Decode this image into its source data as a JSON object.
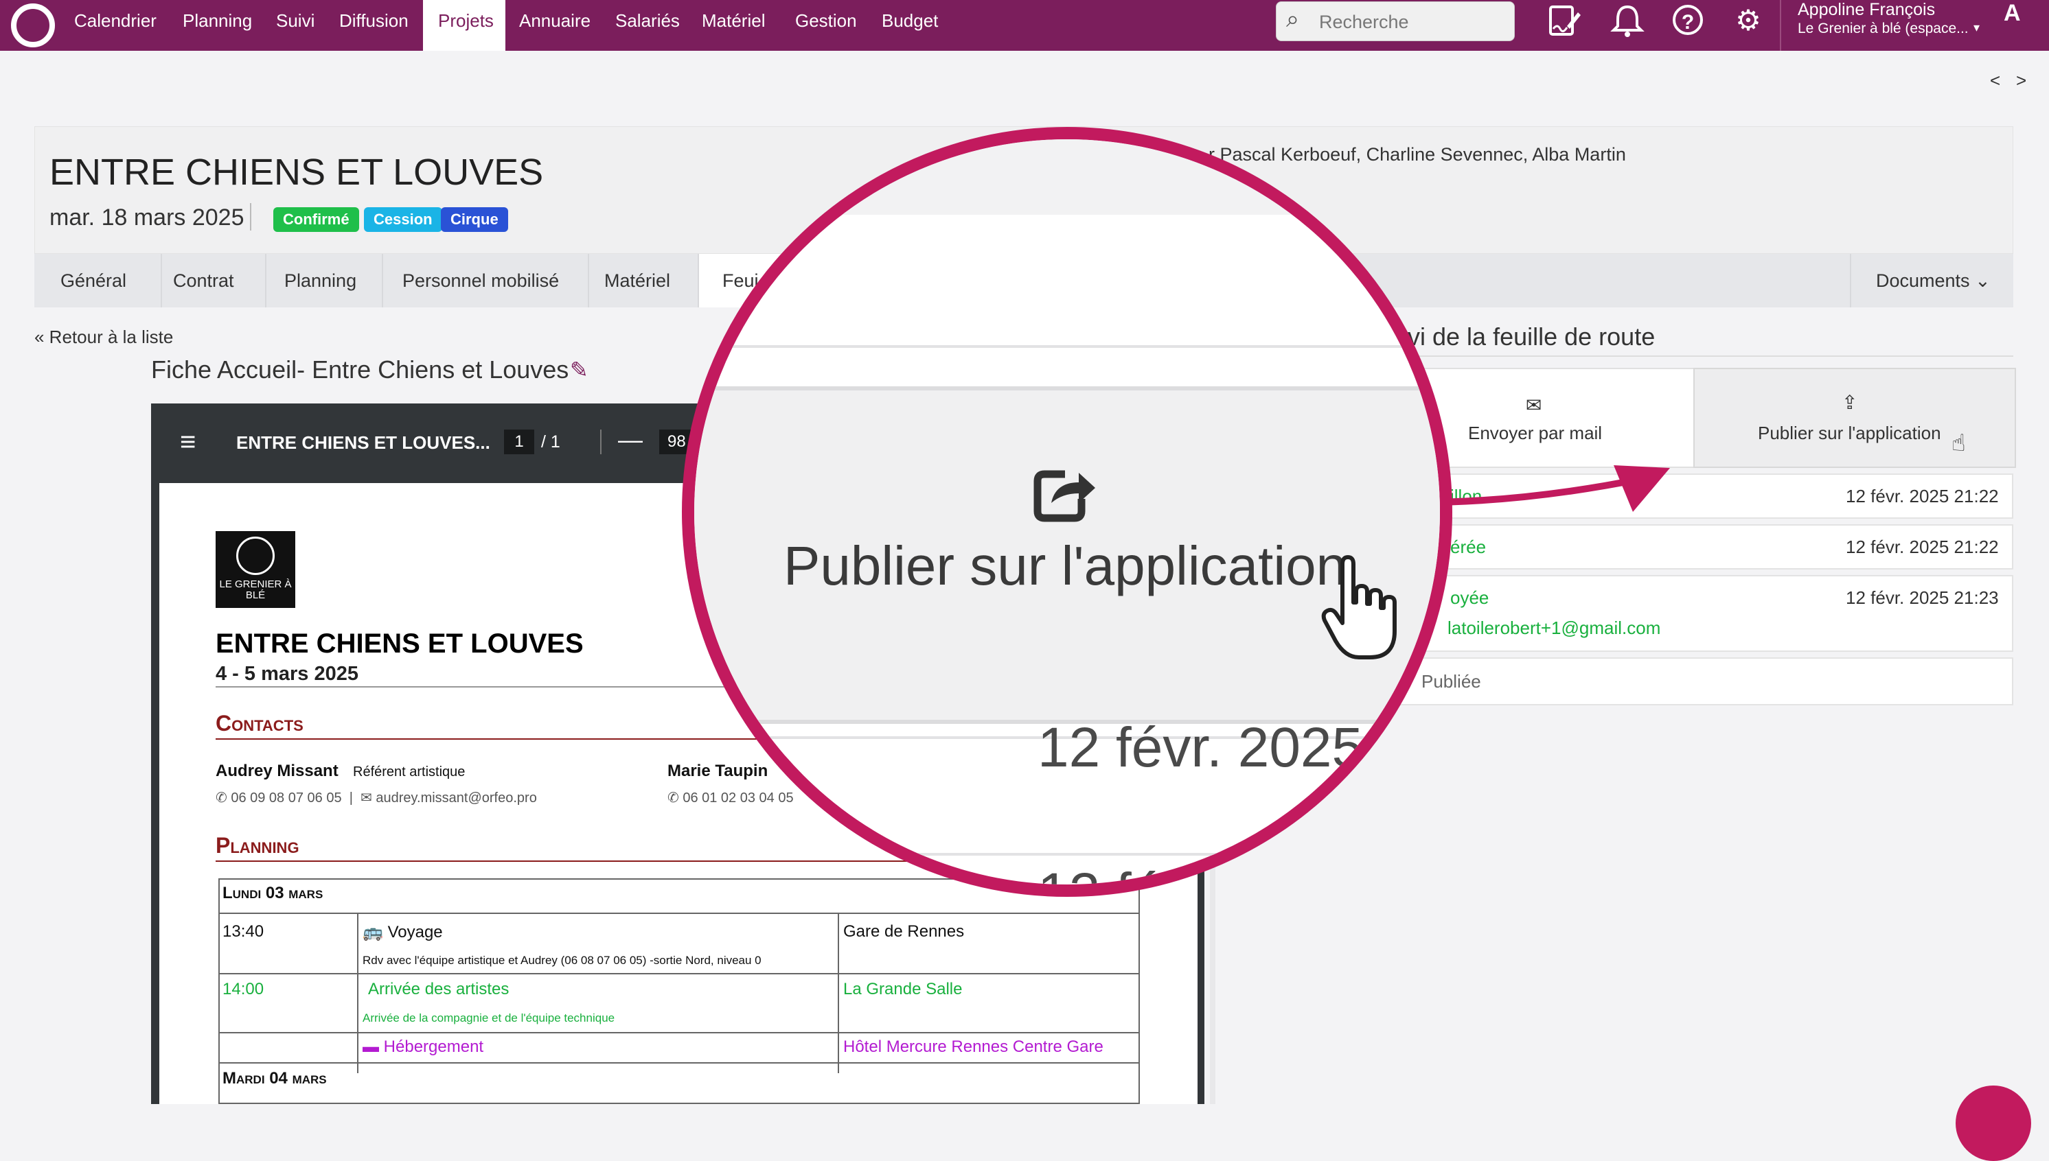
{
  "navbar": {
    "items": [
      {
        "label": "Calendrier",
        "active": false
      },
      {
        "label": "Planning",
        "active": false
      },
      {
        "label": "Suivi",
        "active": false
      },
      {
        "label": "Diffusion",
        "active": false
      },
      {
        "label": "Projets",
        "active": true
      },
      {
        "label": "Annuaire",
        "active": false
      },
      {
        "label": "Salariés",
        "active": false
      },
      {
        "label": "Matériel",
        "active": false
      },
      {
        "label": "Gestion",
        "active": false
      },
      {
        "label": "Budget",
        "active": false
      }
    ],
    "search_placeholder": "Recherche",
    "user_name": "Appoline François",
    "user_org": "Le Grenier à blé (espace...",
    "user_initial": "A",
    "icons": [
      "signature-icon",
      "bell-icon",
      "help-icon",
      "gear-icon"
    ],
    "brand_color": "#7b1e5c"
  },
  "pager": {
    "prev": "<",
    "next": ">"
  },
  "project": {
    "title": "ENTRE CHIENS ET LOUVES",
    "date": "mar. 18 mars 2025",
    "badges": [
      {
        "label": "Confirmé",
        "color": "#1fbf4a"
      },
      {
        "label": "Cession",
        "color": "#1ab4e6"
      },
      {
        "label": "Cirque",
        "color": "#2a52d6"
      }
    ],
    "artists": "r Pascal Kerboeuf, Charline Sevennec, Alba Martin"
  },
  "tabs": [
    {
      "label": "Général",
      "active": false
    },
    {
      "label": "Contrat",
      "active": false
    },
    {
      "label": "Planning",
      "active": false
    },
    {
      "label": "Personnel mobilisé",
      "active": false
    },
    {
      "label": "Matériel",
      "active": false
    },
    {
      "label": "Feui",
      "active": true
    }
  ],
  "documents_label": "Documents",
  "back_link": "« Retour à la liste",
  "doc_title": "Fiche Accueil- Entre Chiens et Louves",
  "pdf": {
    "file_name": "ENTRE CHIENS ET LOUVES...",
    "page_current": "1",
    "page_total": "/  1",
    "zoom": "98",
    "logo_text": "LE GRENIER À BLÉ",
    "heading": "ENTRE CHIENS ET LOUVES",
    "dates": "4 - 5 mars 2025",
    "contacts_title": "Contacts",
    "contacts": [
      {
        "name": "Audrey Missant",
        "role": "Référent artistique",
        "phone": "06 09 08 07 06 05",
        "email": "audrey.missant@orfeo.pro"
      },
      {
        "name": "Marie Taupin",
        "role": "",
        "phone": "06 01 02 03 04 05",
        "email": ""
      }
    ],
    "planning_title": "Planning",
    "days": [
      {
        "label": "Lundi 03 mars"
      },
      {
        "label": "Mardi 04 mars"
      }
    ],
    "rows": [
      {
        "time": "13:40",
        "title": "Voyage",
        "detail": "Rdv avec l'équipe artistique et Audrey (06 08 07 06 05) -sortie Nord, niveau 0",
        "place": "Gare de Rennes",
        "color": "#111111"
      },
      {
        "time": "14:00",
        "title": "Arrivée des artistes",
        "detail": "Arrivée de la compagnie et de l'équipe technique",
        "place": "La Grande Salle",
        "color": "#19b03e"
      },
      {
        "time": "",
        "title": "Hébergement",
        "detail": "",
        "place": "Hôtel Mercure Rennes Centre Gare",
        "color": "#b31bd1"
      }
    ]
  },
  "suivi": {
    "title": "vi de la feuille de route",
    "mail_button": "Envoyer par mail",
    "publish_button": "Publier sur l'application",
    "log": [
      {
        "status": "illon",
        "date": "12 févr. 2025 21:22"
      },
      {
        "status": "érée",
        "date": "12 févr. 2025 21:22"
      },
      {
        "status": "oyée",
        "detail": "latoilerobert+1@gmail.com",
        "date": "12 févr. 2025 21:23"
      },
      {
        "status": "Publiée",
        "date": ""
      }
    ]
  },
  "magnifier": {
    "label": "Publier sur l'application",
    "date_1": "12 févr. 2025 2",
    "date_2": "12 fé",
    "border_color": "#c21a5e"
  }
}
